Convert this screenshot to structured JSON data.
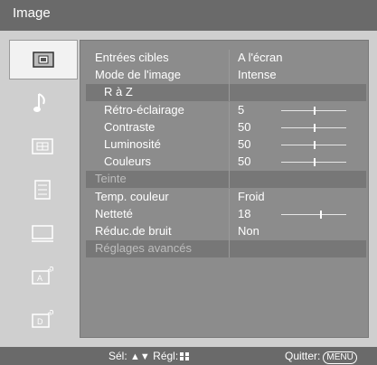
{
  "header": {
    "title": "Image"
  },
  "sidebar": {
    "items": [
      {
        "icon": "picture-icon",
        "selected": true
      },
      {
        "icon": "music-note-icon",
        "selected": false
      },
      {
        "icon": "screen-adjust-icon",
        "selected": false
      },
      {
        "icon": "list-settings-icon",
        "selected": false
      },
      {
        "icon": "monitor-icon",
        "selected": false
      },
      {
        "icon": "analog-channel-icon",
        "selected": false
      },
      {
        "icon": "digital-channel-icon",
        "selected": false
      }
    ]
  },
  "menu": {
    "rows": [
      {
        "label": "Entrées cibles",
        "value": "A l'écran"
      },
      {
        "label": "Mode de l'image",
        "value": "Intense"
      },
      {
        "label": "R à Z",
        "value": ""
      },
      {
        "label": "Rétro-éclairage",
        "value": "5",
        "level": 0.5
      },
      {
        "label": "Contraste",
        "value": "50",
        "level": 0.5
      },
      {
        "label": "Luminosité",
        "value": "50",
        "level": 0.5
      },
      {
        "label": "Couleurs",
        "value": "50",
        "level": 0.5
      },
      {
        "label": "Teinte",
        "value": ""
      },
      {
        "label": "Temp. couleur",
        "value": "Froid"
      },
      {
        "label": "Netteté",
        "value": "18",
        "level": 0.6
      },
      {
        "label": "Réduc.de bruit",
        "value": "Non"
      },
      {
        "label": "Réglages avancés",
        "value": ""
      }
    ]
  },
  "footer": {
    "nav_select": "Sél:",
    "nav_adjust": "Régl:",
    "quit_label": "Quitter:",
    "menu_button": "MENU"
  },
  "colors": {
    "title_bar": "#6a6a6a",
    "panel": "#8c8c8c",
    "highlight": "#777777",
    "sidebar": "#cfcfcf"
  }
}
